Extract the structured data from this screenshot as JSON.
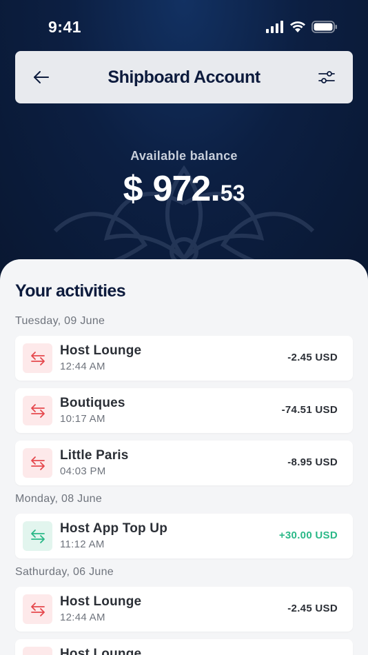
{
  "status_bar": {
    "time": "9:41",
    "icons": [
      "signal-icon",
      "wifi-icon",
      "battery-icon"
    ]
  },
  "header": {
    "title": "Shipboard Account",
    "back_icon": "arrow-left-icon",
    "filter_icon": "sliders-icon"
  },
  "balance": {
    "label": "Available balance",
    "currency": "$",
    "whole": "972",
    "cents": "53"
  },
  "activities": {
    "title": "Your activities",
    "groups": [
      {
        "day": "Tuesday, 09 June",
        "items": [
          {
            "name": "Host Lounge",
            "time": "12:44 AM",
            "amount": "-2.45 USD",
            "direction": "out"
          },
          {
            "name": "Boutiques",
            "time": "10:17 AM",
            "amount": "-74.51 USD",
            "direction": "out"
          },
          {
            "name": "Little Paris",
            "time": "04:03 PM",
            "amount": "-8.95 USD",
            "direction": "out"
          }
        ]
      },
      {
        "day": "Monday, 08 June",
        "items": [
          {
            "name": "Host App Top Up",
            "time": "11:12 AM",
            "amount": "+30.00 USD",
            "direction": "in"
          }
        ]
      },
      {
        "day": "Sathurday, 06 June",
        "items": [
          {
            "name": "Host Lounge",
            "time": "12:44 AM",
            "amount": "-2.45 USD",
            "direction": "out"
          },
          {
            "name": "Host Lounge",
            "time": "",
            "amount": "",
            "direction": "out"
          }
        ]
      }
    ]
  },
  "colors": {
    "hero_dark": "#0b1a36",
    "outgoing": "#e5484d",
    "incoming": "#2ab887",
    "title": "#0d1b3d"
  }
}
